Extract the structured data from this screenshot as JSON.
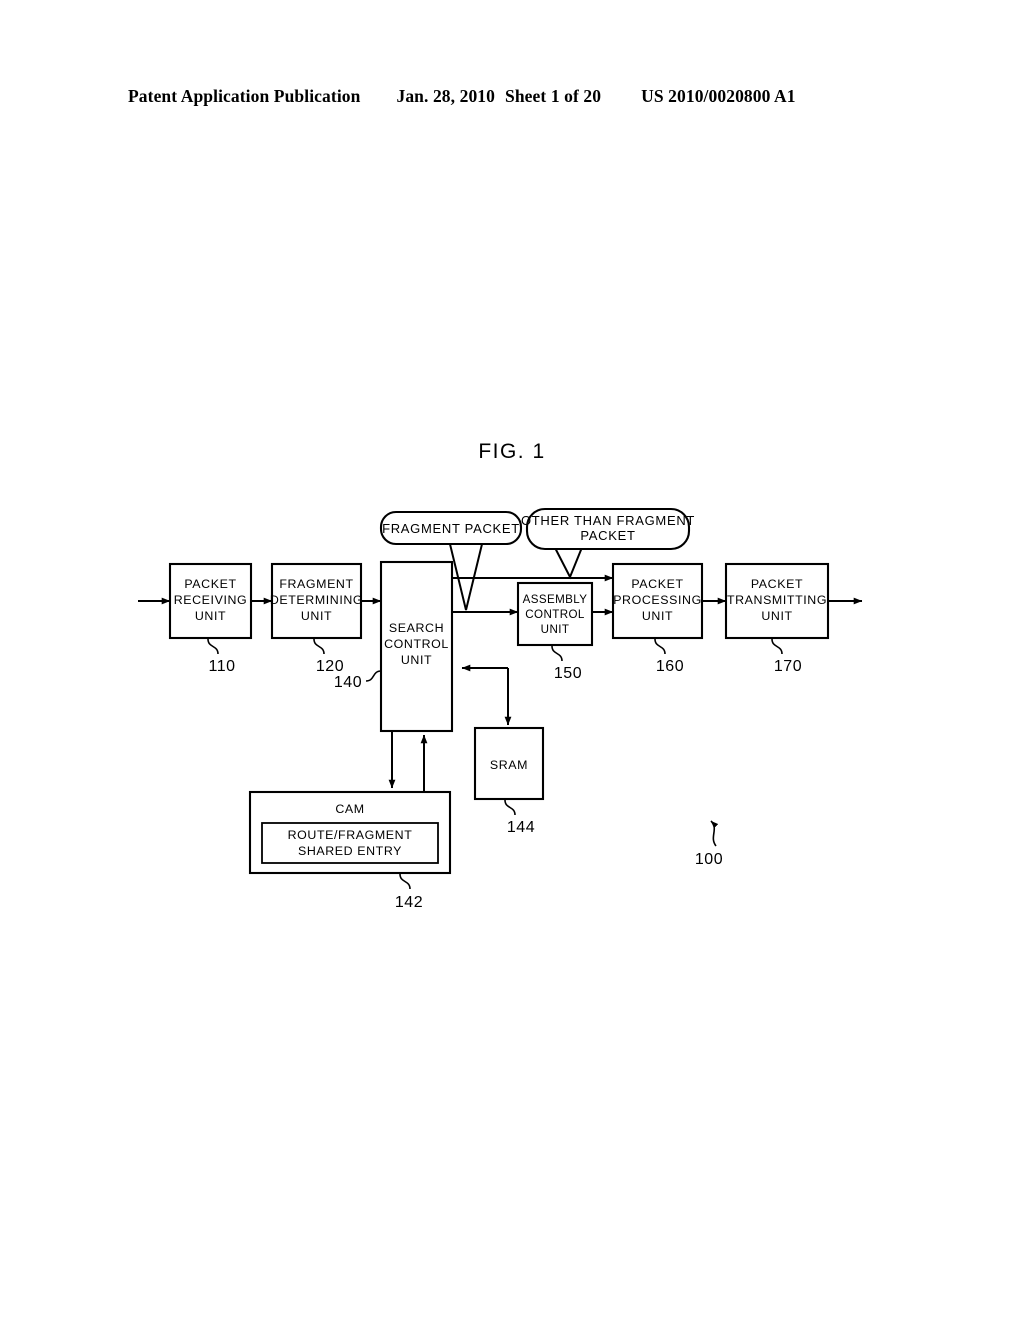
{
  "header": {
    "publication": "Patent Application Publication",
    "date": "Jan. 28, 2010",
    "sheet": "Sheet 1 of 20",
    "document_number": "US 2010/0020800 A1"
  },
  "figure": {
    "caption": "FIG. 1",
    "system_reference": "100",
    "blocks": [
      {
        "id": "packet-receiving-unit",
        "lines": [
          "PACKET",
          "RECEIVING",
          "UNIT"
        ],
        "ref": "110"
      },
      {
        "id": "fragment-determining-unit",
        "lines": [
          "FRAGMENT",
          "DETERMINING",
          "UNIT"
        ],
        "ref": "120"
      },
      {
        "id": "search-control-unit",
        "lines": [
          "SEARCH",
          "CONTROL",
          "UNIT"
        ],
        "ref": "140"
      },
      {
        "id": "assembly-control-unit",
        "lines": [
          "ASSEMBLY",
          "CONTROL",
          "UNIT"
        ],
        "ref": "150"
      },
      {
        "id": "packet-processing-unit",
        "lines": [
          "PACKET",
          "PROCESSING",
          "UNIT"
        ],
        "ref": "160"
      },
      {
        "id": "packet-transmitting-unit",
        "lines": [
          "PACKET",
          "TRANSMITTING",
          "UNIT"
        ],
        "ref": "170"
      },
      {
        "id": "cam",
        "lines": [
          "CAM"
        ],
        "ref": "142"
      },
      {
        "id": "route-fragment-entry",
        "lines": [
          "ROUTE/FRAGMENT",
          "SHARED ENTRY"
        ],
        "ref": "142"
      },
      {
        "id": "sram",
        "lines": [
          "SRAM"
        ],
        "ref": "144"
      }
    ],
    "callouts": [
      {
        "id": "fragment-packet-callout",
        "lines": [
          "FRAGMENT PACKET"
        ]
      },
      {
        "id": "other-than-fragment-packet-callout",
        "lines": [
          "OTHER THAN FRAGMENT",
          "PACKET"
        ]
      }
    ],
    "labels": {
      "packet_receiving_l1": "PACKET",
      "packet_receiving_l2": "RECEIVING",
      "packet_receiving_l3": "UNIT",
      "packet_receiving_ref": "110",
      "fragment_determining_l1": "FRAGMENT",
      "fragment_determining_l2": "DETERMINING",
      "fragment_determining_l3": "UNIT",
      "fragment_determining_ref": "120",
      "search_control_l1": "SEARCH",
      "search_control_l2": "CONTROL",
      "search_control_l3": "UNIT",
      "search_control_ref": "140",
      "assembly_control_l1": "ASSEMBLY",
      "assembly_control_l2": "CONTROL",
      "assembly_control_l3": "UNIT",
      "assembly_control_ref": "150",
      "packet_processing_l1": "PACKET",
      "packet_processing_l2": "PROCESSING",
      "packet_processing_l3": "UNIT",
      "packet_processing_ref": "160",
      "packet_transmitting_l1": "PACKET",
      "packet_transmitting_l2": "TRANSMITTING",
      "packet_transmitting_l3": "UNIT",
      "packet_transmitting_ref": "170",
      "cam_title": "CAM",
      "cam_entry_l1": "ROUTE/FRAGMENT",
      "cam_entry_l2": "SHARED ENTRY",
      "cam_ref": "142",
      "sram_title": "SRAM",
      "sram_ref": "144",
      "callout_fragment": "FRAGMENT PACKET",
      "callout_other_l1": "OTHER THAN FRAGMENT",
      "callout_other_l2": "PACKET",
      "system_ref": "100"
    }
  }
}
